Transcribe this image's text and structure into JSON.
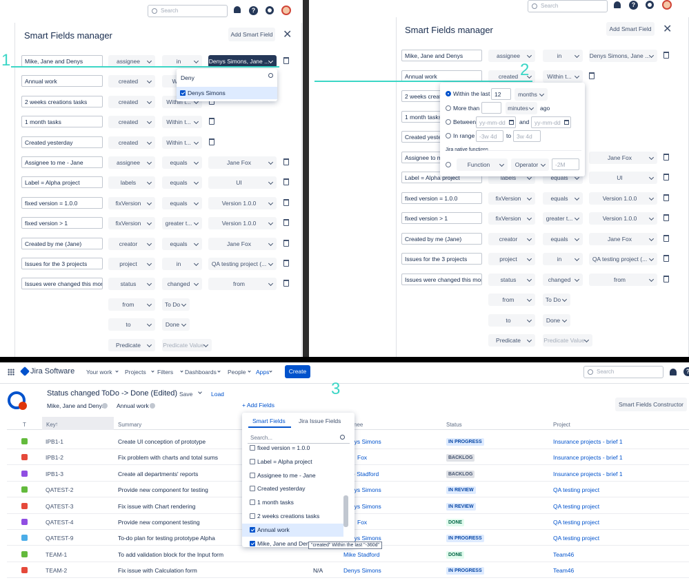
{
  "top_search_placeholder": "Search",
  "annotations": [
    "1",
    "2",
    "3"
  ],
  "panel1": {
    "title": "Smart Fields manager",
    "add_button": "Add Smart Field",
    "rows": [
      {
        "name": "Mike, Jane and Denys",
        "field": "assignee",
        "op": "in",
        "value": "Denys Simons, Jane ..."
      },
      {
        "name": "Annual work",
        "field": "created",
        "op": "Withi",
        "value": ""
      },
      {
        "name": "2 weeks creations tasks",
        "field": "created",
        "op": "Within t...",
        "value": ""
      },
      {
        "name": "1 month tasks",
        "field": "created",
        "op": "Within t...",
        "value": ""
      },
      {
        "name": "Created yesterday",
        "field": "created",
        "op": "Within t...",
        "value": ""
      },
      {
        "name": "Assignee to me - Jane",
        "field": "assignee",
        "op": "equals",
        "value": "Jane Fox"
      },
      {
        "name": "Label = Alpha project",
        "field": "labels",
        "op": "equals",
        "value": "UI"
      },
      {
        "name": "fixed version = 1.0.0",
        "field": "fixVersion",
        "op": "equals",
        "value": "Version 1.0.0"
      },
      {
        "name": "fixed version > 1",
        "field": "fixVersion",
        "op": "greater t...",
        "value": "Version 1.0.0"
      },
      {
        "name": "Created by me (Jane)",
        "field": "creator",
        "op": "equals",
        "value": "Jane Fox"
      },
      {
        "name": "Issues for the 3 projects",
        "field": "project",
        "op": "in",
        "value": "QA testing project (..."
      },
      {
        "name": "Issues were changed this mont",
        "field": "status",
        "op": "changed",
        "value": "from"
      }
    ],
    "sub_rows": [
      {
        "a": "from",
        "b": "To Do"
      },
      {
        "a": "to",
        "b": "Done"
      },
      {
        "a": "Predicate",
        "b": "Predicate Value"
      }
    ],
    "user_popup": {
      "query": "Deny",
      "option": "Denys Simons"
    }
  },
  "panel2": {
    "title": "Smart Fields manager",
    "add_button": "Add Smart Field",
    "rows": [
      {
        "name": "Mike, Jane and Denys",
        "field": "assignee",
        "op": "in",
        "value": "Denys Simons, Jane ..."
      },
      {
        "name": "Annual work",
        "field": "created",
        "op": "Within t...",
        "value": ""
      },
      {
        "name": "2 weeks creati",
        "field": "",
        "op": "",
        "value": ""
      },
      {
        "name": "1 month tasks",
        "field": "",
        "op": "",
        "value": ""
      },
      {
        "name": "Created yester",
        "field": "",
        "op": "",
        "value": ""
      },
      {
        "name": "Assignee to m",
        "field": "",
        "op": "",
        "value": "Jane Fox"
      },
      {
        "name": "Label = Alpha project",
        "field": "labels",
        "op": "equals",
        "value": "UI"
      },
      {
        "name": "fixed version = 1.0.0",
        "field": "fixVersion",
        "op": "equals",
        "value": "Version 1.0.0"
      },
      {
        "name": "fixed version > 1",
        "field": "fixVersion",
        "op": "greater t...",
        "value": "Version 1.0.0"
      },
      {
        "name": "Created by me (Jane)",
        "field": "creator",
        "op": "equals",
        "value": "Jane Fox"
      },
      {
        "name": "Issues for the 3 projects",
        "field": "project",
        "op": "in",
        "value": "QA testing project (..."
      },
      {
        "name": "Issues were changed this mont",
        "field": "status",
        "op": "changed",
        "value": "from"
      }
    ],
    "sub_rows": [
      {
        "a": "from",
        "b": "To Do"
      },
      {
        "a": "to",
        "b": "Done"
      },
      {
        "a": "Predicate",
        "b": "Predicate Value"
      }
    ],
    "date_popup": {
      "within_label": "Within the last",
      "within_value": "12",
      "within_unit": "months",
      "more_label": "More than",
      "more_unit": "minutes",
      "ago": "ago",
      "between_label": "Between",
      "date_ph": "yy-mm-dd",
      "and": "and",
      "range_label": "In range",
      "range_from": "-3w 4d",
      "to": "to",
      "range_to": "3w 4d",
      "native_title": "Jira native functions",
      "function": "Function",
      "operator": "Operator",
      "fn_value": "-2M"
    }
  },
  "jira": {
    "logo": "Jira Software",
    "nav": [
      "Your work",
      "Projects",
      "Filters",
      "Dashboards",
      "People",
      "Apps"
    ],
    "create": "Create",
    "search": "Search",
    "filter_title": "Status changed ToDo -> Done (Edited)",
    "save": "Save",
    "load": "Load",
    "chips": [
      "Mike, Jane and Denys",
      "Annual work"
    ],
    "add_fields": "+ Add Fields",
    "constructor_btn": "Smart Fields Constructor",
    "columns": {
      "t": "T",
      "key": "Key",
      "summary": "Summary",
      "assignee": "nee",
      "status": "Status",
      "project": "Project"
    },
    "rows": [
      {
        "key": "IPB1-1",
        "summary": "Create UI conception of prototype",
        "na": "",
        "assignee": "Denys Simons",
        "status": "IN PROGRESS",
        "project": "Insurance projects - brief 1",
        "type": "story"
      },
      {
        "key": "IPB1-2",
        "summary": "Fix problem with charts and total sums",
        "na": "",
        "assignee": "Fox",
        "status": "BACKLOG",
        "project": "Insurance projects - brief 1",
        "type": "bug"
      },
      {
        "key": "IPB1-3",
        "summary": "Create all departments' reports",
        "na": "",
        "assignee": "e Stadford",
        "status": "BACKLOG",
        "project": "Insurance projects - brief 1",
        "type": "epic"
      },
      {
        "key": "QATEST-2",
        "summary": "Provide new component for testing",
        "na": "",
        "assignee": "Denys Simons",
        "status": "IN REVIEW",
        "project": "QA testing project",
        "type": "improvement"
      },
      {
        "key": "QATEST-3",
        "summary": "Fix issue with Chart rendering",
        "na": "",
        "assignee": "Denys Simons",
        "status": "IN REVIEW",
        "project": "QA testing project",
        "type": "bug"
      },
      {
        "key": "QATEST-4",
        "summary": "Provide new component testing",
        "na": "",
        "assignee": "Fox",
        "status": "DONE",
        "project": "QA testing project",
        "type": "epic"
      },
      {
        "key": "QATEST-9",
        "summary": "To-do plan for testing prototype Alpha",
        "na": "",
        "assignee": "Denys Simons",
        "status": "IN PROGRESS",
        "project": "QA testing project",
        "type": "task"
      },
      {
        "key": "TEAM-1",
        "summary": "To add validation block for the Input form",
        "na": "",
        "assignee": "Mike Stadford",
        "status": "DONE",
        "project": "Team46",
        "type": "story"
      },
      {
        "key": "TEAM-2",
        "summary": "Fix issue with Calculation form",
        "na": "N/A",
        "assignee": "Denys Simons",
        "status": "IN PROGRESS",
        "project": "Team46",
        "type": "bug"
      }
    ],
    "fields_popup": {
      "tabs": [
        "Smart Fields",
        "Jira Issue Fields"
      ],
      "search_placeholder": "Search...",
      "items": [
        {
          "label": "fixed version = 1.0.0",
          "checked": false
        },
        {
          "label": "Label = Alpha project",
          "checked": false
        },
        {
          "label": "Assignee to me - Jane",
          "checked": false
        },
        {
          "label": "Created yesterday",
          "checked": false
        },
        {
          "label": "1 month tasks",
          "checked": false
        },
        {
          "label": "2 weeks creations tasks",
          "checked": false
        },
        {
          "label": "Annual work",
          "checked": true
        },
        {
          "label": "Mike, Jane and Den",
          "checked": true
        }
      ],
      "tooltip": "\"created\" Within the last \"-360d\""
    }
  }
}
